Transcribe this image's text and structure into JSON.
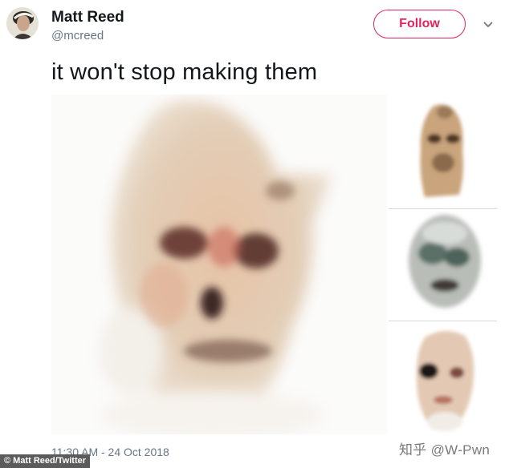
{
  "user": {
    "name": "Matt Reed",
    "handle": "@mcreed",
    "avatar_icon": "user-avatar"
  },
  "follow_button": {
    "label": "Follow",
    "color": "#e0245e"
  },
  "menu": {
    "icon": "chevron-down-icon"
  },
  "tweet": {
    "text": "it won't stop making them",
    "timestamp": "11:30 AM - 24 Oct 2018"
  },
  "media": {
    "main_image": "generated-face-image",
    "thumbnails": [
      "generated-face-thumbnail-1",
      "generated-face-thumbnail-2",
      "generated-face-thumbnail-3"
    ]
  },
  "overlay": {
    "credit": "© Matt Reed/Twitter",
    "watermark": "知乎 @W-Pwn"
  },
  "colors": {
    "name": "#14171a",
    "secondary": "#657786"
  }
}
